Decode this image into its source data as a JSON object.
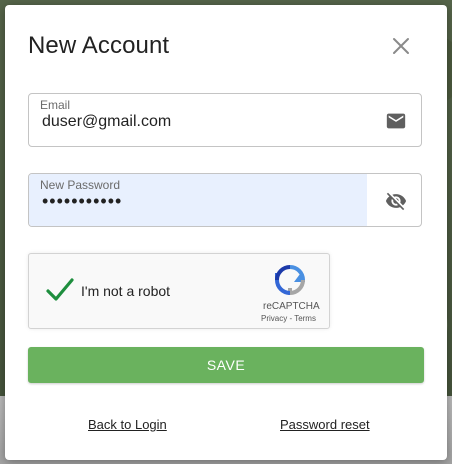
{
  "dialog": {
    "title": "New Account"
  },
  "email": {
    "label": "Email",
    "value": "duser@gmail.com",
    "icon": "mail-icon"
  },
  "password": {
    "label": "New Password",
    "value": "•••••••••••",
    "icon": "visibility-off-icon"
  },
  "captcha": {
    "label": "I'm not a robot",
    "brand": "reCAPTCHA",
    "links": "Privacy - Terms",
    "checked": true
  },
  "actions": {
    "save_label": "SAVE",
    "back_label": "Back to Login",
    "reset_label": "Password reset"
  },
  "colors": {
    "save_button": "#6ab25e",
    "autofill_bg": "#e8f0fe",
    "check_green": "#1e8e3e"
  }
}
